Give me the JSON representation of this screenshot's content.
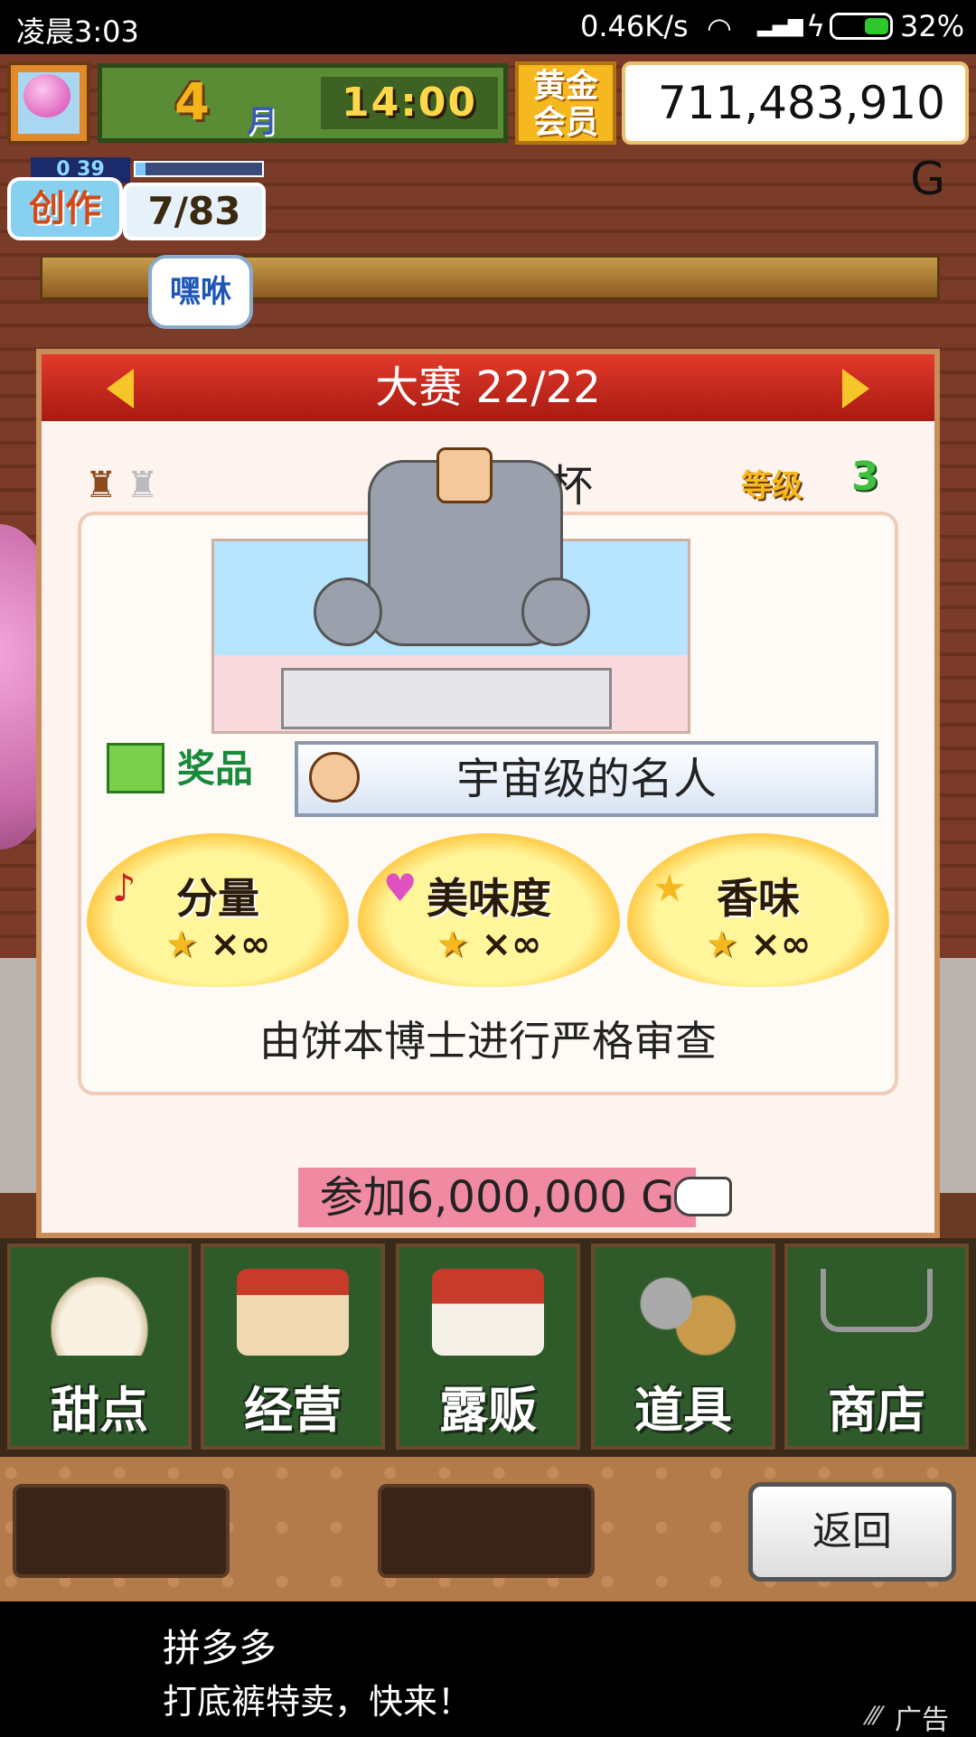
{
  "status_bar": {
    "time": "凌晨3:03",
    "network_speed": "0.46K/s",
    "battery_percent": "32%"
  },
  "hud": {
    "month_number": "4",
    "month_unit": "月",
    "clock": "14:00",
    "vip_badge": "黄金会员",
    "money": "711,483,910 G",
    "create_label": "创作",
    "create_progress": "7/83",
    "create_counter": "0 39",
    "speech_bubble": "嘿咻"
  },
  "contest": {
    "header": "大赛 22/22",
    "name": "超级大本杯",
    "level_label": "等级",
    "level_value": "3",
    "prize_label": "奖品",
    "prize_name": "宇宙级的名人",
    "criteria": [
      {
        "name": "分量",
        "icon": "music-note-icon",
        "mult": "×∞"
      },
      {
        "name": "美味度",
        "icon": "heart-icon",
        "mult": "×∞"
      },
      {
        "name": "香味",
        "icon": "star-icon",
        "mult": "×∞"
      }
    ],
    "judge_text": "由饼本博士进行严格审查",
    "join_label": "参加6,000,000 G"
  },
  "menu": {
    "items": [
      {
        "label": "甜点",
        "icon": "cake-icon"
      },
      {
        "label": "经营",
        "icon": "store-icon"
      },
      {
        "label": "露贩",
        "icon": "food-truck-icon"
      },
      {
        "label": "道具",
        "icon": "gear-bag-icon"
      },
      {
        "label": "商店",
        "icon": "cart-icon"
      }
    ]
  },
  "back_label": "返回",
  "ad": {
    "title": "拼多多",
    "subtitle": "打底裤特卖，快来！",
    "tag": "广告"
  }
}
